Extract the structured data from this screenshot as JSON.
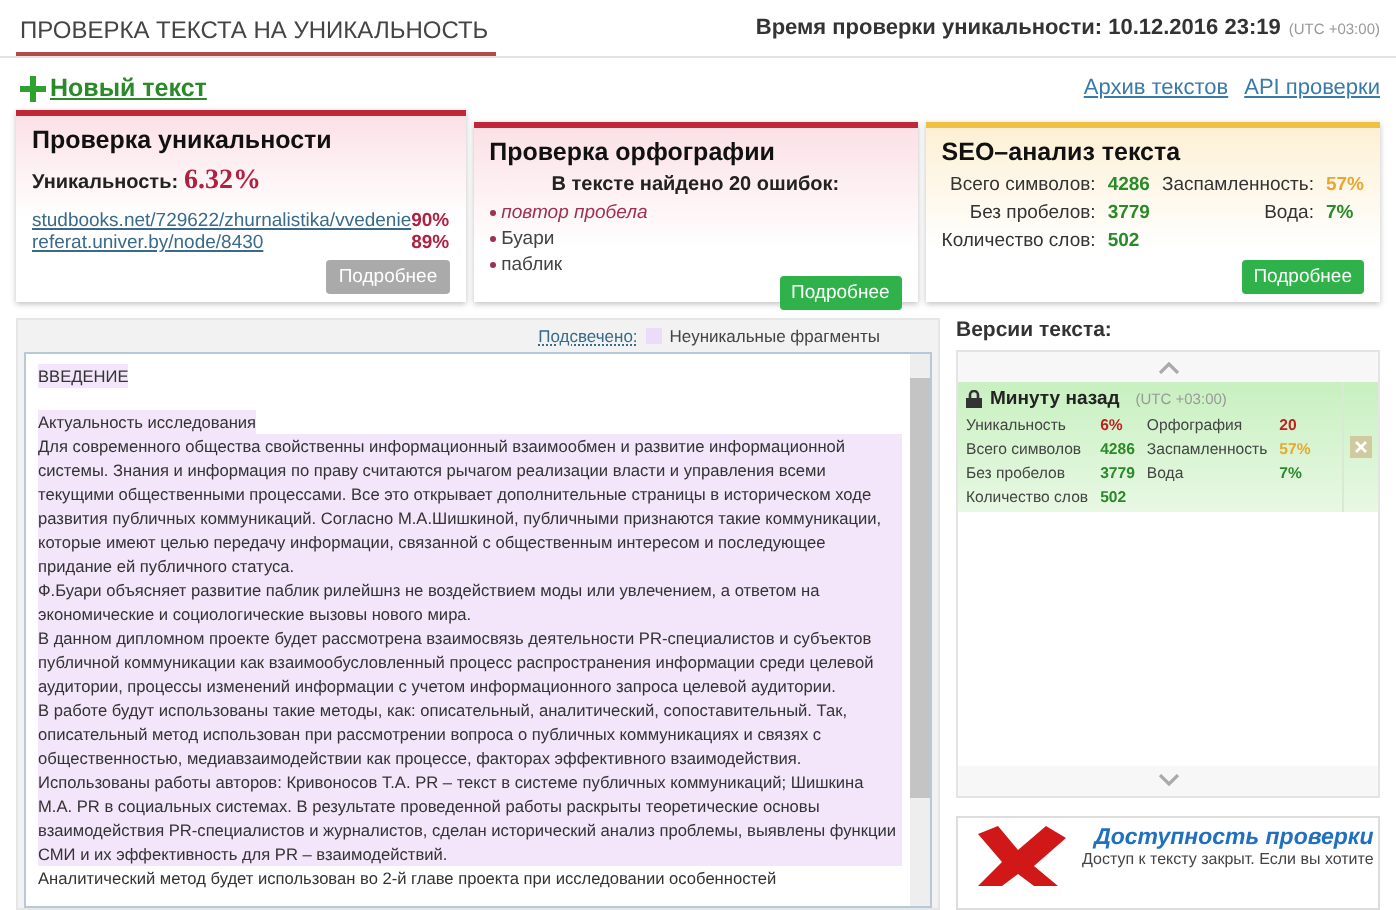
{
  "header": {
    "title": "ПРОВЕРКА ТЕКСТА НА УНИКАЛЬНОСТЬ",
    "time_label": "Время проверки уникальности: 10.12.2016 23:19",
    "timezone": "(UTC +03:00)"
  },
  "toolbar": {
    "new_text": "Новый текст",
    "links": [
      "Архив текстов",
      "API проверки"
    ]
  },
  "uniqueness_card": {
    "title": "Проверка уникальности",
    "label": "Уникальность:",
    "value": "6.32%",
    "sources": [
      {
        "url": "studbooks.net/729622/zhurnalistika/vvedenie",
        "percent": "90%"
      },
      {
        "url": "referat.univer.by/node/8430",
        "percent": "89%"
      }
    ],
    "button": {
      "label": "Подробнее",
      "disabled": true
    }
  },
  "spelling_card": {
    "title": "Проверка орфографии",
    "summary": "В тексте найдено 20 ошибок:",
    "errors": [
      {
        "text": "повтор пробела",
        "kind": "note"
      },
      {
        "text": "Буари",
        "kind": "word"
      },
      {
        "text": "паблик",
        "kind": "word"
      }
    ],
    "button": {
      "label": "Подробнее",
      "disabled": false
    }
  },
  "seo_card": {
    "title": "SEO–анализ текста",
    "stats": [
      {
        "label": "Всего символов:",
        "value": "4286",
        "color": "#2a8a2a"
      },
      {
        "label": "Заспамленность:",
        "value": "57%",
        "color": "#e8a830"
      },
      {
        "label": "Без пробелов:",
        "value": "3779",
        "color": "#2a8a2a"
      },
      {
        "label": "Вода:",
        "value": "7%",
        "color": "#2a8a2a"
      },
      {
        "label": "Количество слов:",
        "value": "502",
        "color": "#2a8a2a"
      }
    ],
    "button": {
      "label": "Подробнее",
      "disabled": false
    }
  },
  "legend": {
    "link": "Подсвечено:",
    "label": "Неуникальные фрагменты"
  },
  "text_panel": {
    "paragraphs": [
      {
        "text": "ВВЕДЕНИЕ",
        "highlighted": true,
        "gap_after": true
      },
      {
        "text": "Актуальность исследования",
        "highlighted": true,
        "gap_after": false
      },
      {
        "text": "Для современного общества свойственны информационный взаимообмен и развитие информационной системы. Знания и информация по праву считаются рычагом реализации власти и управления всеми текущими общественными процессами. Все это открывает дополнительные страницы в историческом ходе развития публичных коммуникаций. Согласно М.А.Шишкиной, публичными признаются такие коммуникации, которые имеют целью  передачу информации, связанной с общественным интересом и последующее придание ей публичного статуса.",
        "highlighted": true,
        "gap_after": false
      },
      {
        "text": "Ф.Буари объясняет развитие паблик рилейшнз не воздействием моды или увлечением, а ответом на экономические и социологические вызовы нового мира.",
        "highlighted": true,
        "gap_after": false
      },
      {
        "text": "В данном дипломном проекте будет рассмотрена  взаимосвязь деятельности PR-специалистов и субъектов публичной коммуникации как  взаимообусловленный процесс распространения информации среди целевой аудитории, процессы изменений информации с учетом информационного запроса целевой аудитории.",
        "highlighted": true,
        "gap_after": false
      },
      {
        "text": "В работе будут использованы такие методы, как: описательный, аналитический, сопоставительный. Так, описательный метод использован при рассмотрении вопроса о публичных коммуникациях и связях с общественностью, медиавзаимодействии как процессе, факторах эффективного взаимодействия.",
        "highlighted": true,
        "gap_after": false
      },
      {
        "text": "Использованы работы авторов: Кривоносов Т.А. PR – текст в системе публичных коммуникаций; Шишкина М.А. PR в социальных системах. В результате проведенной работы раскрыты теоретические основы взаимодействия PR-специалистов и журналистов, сделан исторический анализ проблемы, выявлены функции СМИ и их эффективность для PR – взаимодействий.",
        "highlighted": true,
        "gap_after": false
      },
      {
        "text": "Аналитический метод будет использован во 2-й главе проекта при исследовании особенностей",
        "highlighted": false,
        "gap_after": false
      }
    ]
  },
  "versions": {
    "title": "Версии текста:",
    "items": [
      {
        "title": "Минуту назад",
        "timezone": "(UTC +03:00)",
        "selected": true,
        "stats": [
          {
            "label": "Уникальность",
            "value": "6%",
            "color": "#c02020"
          },
          {
            "label": "Орфография",
            "value": "20",
            "color": "#c02020"
          },
          {
            "label": "Всего символов",
            "value": "4286",
            "color": "#2a8a2a"
          },
          {
            "label": "Заспамленность",
            "value": "57%",
            "color": "#e8a830"
          },
          {
            "label": "Без пробелов",
            "value": "3779",
            "color": "#2a8a2a"
          },
          {
            "label": "Вода",
            "value": "7%",
            "color": "#2a8a2a"
          },
          {
            "label": "Количество слов",
            "value": "502",
            "color": "#2a8a2a"
          }
        ]
      }
    ]
  },
  "access_promo": {
    "title": "Доступность проверки",
    "text": "Доступ к тексту закрыт. Если вы хотите"
  }
}
